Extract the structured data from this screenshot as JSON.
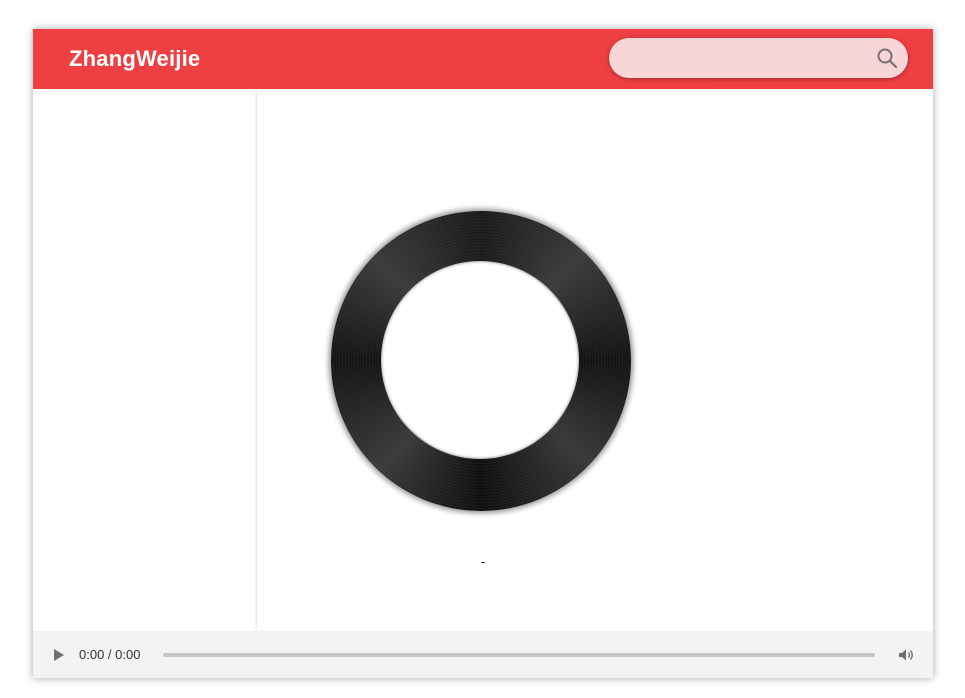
{
  "header": {
    "brand": "ZhangWeijie",
    "search": {
      "value": "",
      "placeholder": "",
      "icon": "search-icon"
    }
  },
  "main": {
    "record_icon": "vinyl-record",
    "song_info": "-"
  },
  "player": {
    "time": "0:00 / 0:00",
    "progress": 0,
    "play_icon": "play-icon",
    "volume_icon": "volume-icon"
  },
  "colors": {
    "accent": "#ee3f42",
    "search_bg": "#f8d6d7",
    "player_bg": "#f1f3f4"
  }
}
